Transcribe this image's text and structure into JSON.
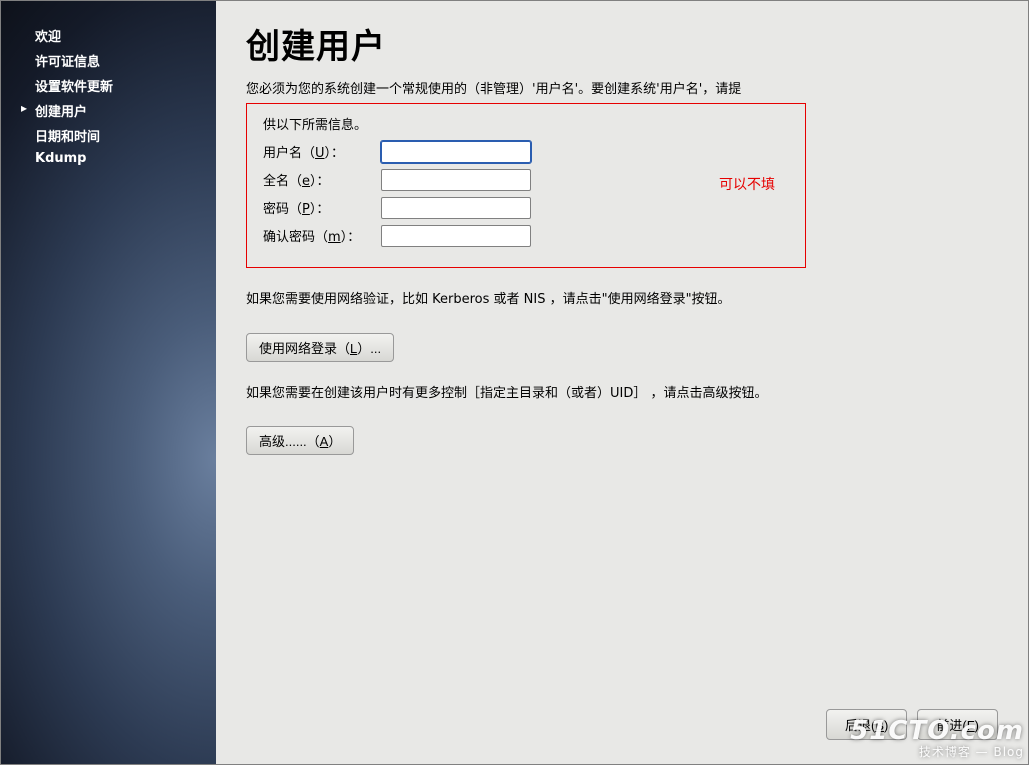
{
  "sidebar": {
    "items": [
      {
        "label": "欢迎",
        "active": false
      },
      {
        "label": "许可证信息",
        "active": false
      },
      {
        "label": "设置软件更新",
        "active": false
      },
      {
        "label": "创建用户",
        "active": true
      },
      {
        "label": "日期和时间",
        "active": false
      },
      {
        "label": "Kdump",
        "active": false
      }
    ]
  },
  "main": {
    "title": "创建用户",
    "intro_line1": "您必须为您的系统创建一个常规使用的（非管理）'用户名'。要创建系统'用户名'，请提",
    "intro_line2": "供以下所需信息。",
    "annotation": "可以不填",
    "form": {
      "username_label_pre": "用户名（",
      "username_key": "U",
      "username_label_post": "）：",
      "fullname_label_pre": "全名（",
      "fullname_key": "e",
      "fullname_label_post": "）：",
      "password_label_pre": "密码（",
      "password_key": "P",
      "password_label_post": "）：",
      "confirm_label_pre": "确认密码（",
      "confirm_key": "m",
      "confirm_label_post": "）：",
      "username_value": "",
      "fullname_value": "",
      "password_value": "",
      "confirm_value": ""
    },
    "network_text": "如果您需要使用网络验证，比如 Kerberos 或者 NIS ，请点击\"使用网络登录\"按钮。",
    "network_btn_pre": "使用网络登录（",
    "network_btn_key": "L",
    "network_btn_post": "）...",
    "advanced_text": "如果您需要在创建该用户时有更多控制［指定主目录和（或者）UID］ ，请点击高级按钮。",
    "advanced_btn_pre": "高级......（",
    "advanced_btn_key": "A",
    "advanced_btn_post": "）"
  },
  "bottom": {
    "back_pre": "后退(",
    "back_key": "B",
    "back_post": ")",
    "forward_pre": "前进(",
    "forward_key": "F",
    "forward_post": ")"
  },
  "watermark": {
    "line1": "51CTO.com",
    "line2": "技术博客 — Blog"
  }
}
